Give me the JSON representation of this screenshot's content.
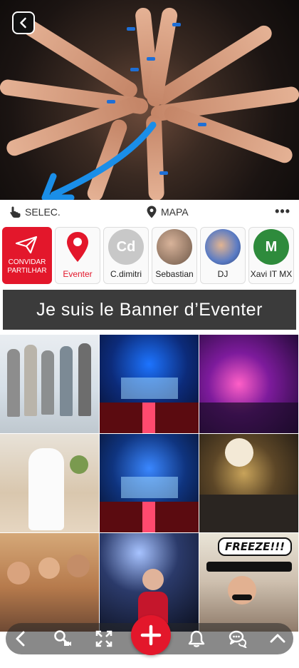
{
  "toolbar": {
    "select_label": "SELEC.",
    "map_label": "MAPA",
    "more_label": "•••"
  },
  "contacts": {
    "invite_label": "CONVIDAR PARTILHAR",
    "items": [
      {
        "label": "Eventer",
        "icon": "location-pin-icon",
        "initials": ""
      },
      {
        "label": "C.dimitri",
        "initials": "Cd",
        "color": "#c8c8c8"
      },
      {
        "label": "Sebastian",
        "initials": "",
        "color": "#a68c7a"
      },
      {
        "label": "DJ",
        "initials": "",
        "color": "#5a7bc4"
      },
      {
        "label": "Xavi IT MX",
        "initials": "M",
        "color": "#2e8b3c"
      }
    ]
  },
  "banner": {
    "text": "Je suis le Banner d’Eventer"
  },
  "gallery": {
    "freeze_text": "FREEZE!!!"
  },
  "colors": {
    "accent": "#e3172b",
    "banner_bg": "#3b3b3b",
    "arrow": "#1a8ee8"
  }
}
